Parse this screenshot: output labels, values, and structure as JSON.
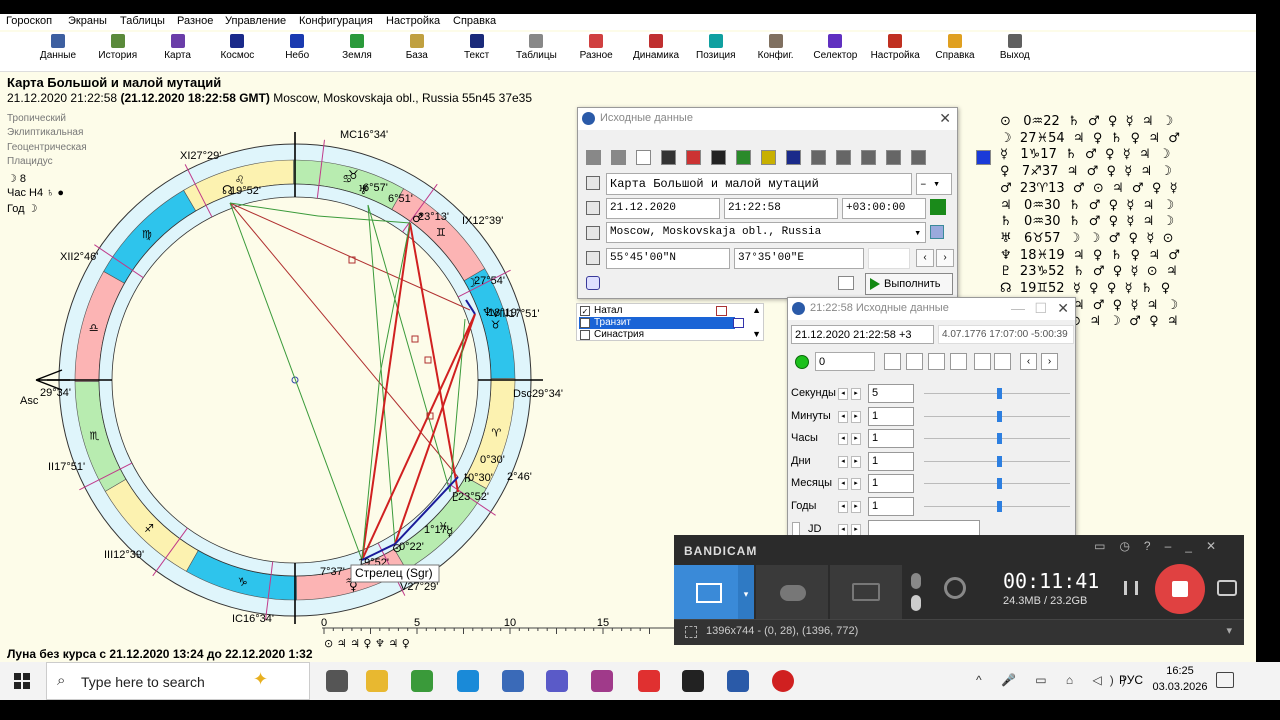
{
  "menu": [
    "Гороскоп",
    "Экраны",
    "Таблицы",
    "Разное",
    "Управление",
    "Конфигурация",
    "Настройка",
    "Справка"
  ],
  "toolbar": [
    {
      "label": "Данные",
      "icon": "data-icon",
      "color": "#3d5fa0"
    },
    {
      "label": "История",
      "icon": "history-icon",
      "color": "#5a8a3a"
    },
    {
      "label": "Карта",
      "icon": "chart-icon",
      "color": "#6a3da8"
    },
    {
      "label": "Космос",
      "icon": "cosmos-icon",
      "color": "#1a2a8a"
    },
    {
      "label": "Небо",
      "icon": "sky-icon",
      "color": "#1a3ab0"
    },
    {
      "label": "Земля",
      "icon": "earth-icon",
      "color": "#2a9a3a"
    },
    {
      "label": "База",
      "icon": "database-icon",
      "color": "#c0a040"
    },
    {
      "label": "Текст",
      "icon": "text-icon",
      "color": "#1a2a7a"
    },
    {
      "label": "Таблицы",
      "icon": "tables-icon",
      "color": "#888888"
    },
    {
      "label": "Разное",
      "icon": "misc-icon",
      "color": "#d04040"
    },
    {
      "label": "Динамика",
      "icon": "dynamics-icon",
      "color": "#c03030"
    },
    {
      "label": "Позиция",
      "icon": "position-icon",
      "color": "#10a0a0"
    },
    {
      "label": "Конфиг.",
      "icon": "config-icon",
      "color": "#807060"
    },
    {
      "label": "Селектор",
      "icon": "selector-icon",
      "color": "#6030c0"
    },
    {
      "label": "Настройка",
      "icon": "settings-icon",
      "color": "#c03020"
    },
    {
      "label": "Справка",
      "icon": "help-icon",
      "color": "#e0a020"
    },
    {
      "label": "Выход",
      "icon": "exit-icon",
      "color": "#606060"
    }
  ],
  "chart": {
    "title": "Карта Большой и малой мутаций",
    "date_plain": "21.12.2020   21:22:58",
    "date_gmt": "(21.12.2020  18:22:58 GMT)",
    "place": "Moscow, Moskovskaja obl., Russia 55n45  37e35",
    "system": [
      "Тропический",
      "Эклиптикальная",
      "Геоцентрическая",
      "Плацидус"
    ],
    "info": [
      "☽  8",
      "Час H4  ♄  ●",
      "Год  ☽"
    ],
    "moon_void": "Луна без курса с 21.12.2020 13:24 до 22.12.2020  1:32",
    "tooltip": "Стрелец (Sgr)",
    "house_labels": [
      "MC16°34'",
      "XI27°29'",
      "XII2°46'",
      "Asc",
      "29°34'",
      "II17°51'",
      "III12°39'",
      "IC16°34'",
      "Dsc29°34'",
      "IX12°39'",
      "VIII17°51'",
      "2°46'",
      "V27°29'"
    ],
    "planet_labels": [
      "19°52'",
      "6°57'",
      "6°51'",
      "23°13'",
      "27°54'",
      "18°19'",
      "0°30'",
      "0°30'",
      "23°52'",
      "1°17'",
      "0°22'",
      "7°37'",
      "19°52'"
    ],
    "scale": [
      "0",
      "5",
      "10",
      "15"
    ]
  },
  "aspect_grid": [
    "⊙   0♒22  ♄  ♂  ♀  ☿  ♃  ☽",
    "☽  27♓54  ♃  ♀  ♄  ♀  ♃  ♂",
    "☿   1♑17  ♄  ♂  ♀  ☿  ♃  ☽",
    "♀   7♐37  ♃  ♂  ♀  ☿  ♃  ☽",
    "♂  23♈13  ♂  ⊙  ♃  ♂  ♀  ☿",
    "♃   0♒30  ♄  ♂  ♀  ☿  ♃  ☽",
    "♄   0♒30  ♄  ♂  ♀  ☿  ♃  ☽",
    "♅   6♉57  ☽  ☽  ♂  ♀  ☿  ⊙",
    "♆  18♓19  ♃  ♀  ♄  ♀  ♃  ♂",
    "♇  23♑52  ♄  ♂  ♀  ☿  ⊙  ♃",
    "☊  19♊52  ☿  ♀  ♀  ☿  ♄  ♀",
    "☋  19♐52  ♃  ♂  ♀  ☿  ♃  ☽",
    "A  29♌34  ⊙  ♃  ☽  ♂  ♀  ♃"
  ],
  "dialog_main": {
    "title": "Исходные данные",
    "name": "Карта Большой и малой мутаций",
    "name_opt": "–",
    "date": "21.12.2020",
    "time": "21:22:58",
    "tz": "+03:00:00",
    "place": "Moscow, Moskovskaja obl., Russia",
    "lat": "55°45'00\"N",
    "lon": "37°35'00\"E",
    "run_button": "Выполнить"
  },
  "chart_types": [
    {
      "label": "Натал",
      "checked": true
    },
    {
      "label": "Транзит",
      "checked": false
    },
    {
      "label": "Синастрия",
      "checked": false
    }
  ],
  "dialog_transit": {
    "title": "21:22:58 Исходные данные",
    "field_left": "21.12.2020  21:22:58  +3",
    "field_right": "4.07.1776   17:07:00  -5:00:39",
    "counter": "0",
    "rows": [
      {
        "label": "Секунды",
        "value": "5",
        "level": 0.5
      },
      {
        "label": "Минуты",
        "value": "1",
        "level": 0.5
      },
      {
        "label": "Часы",
        "value": "1",
        "level": 0.5
      },
      {
        "label": "Дни",
        "value": "1",
        "level": 0.5
      },
      {
        "label": "Месяцы",
        "value": "1",
        "level": 0.5
      },
      {
        "label": "Годы",
        "value": "1",
        "level": 0.5
      }
    ],
    "jd_label": "JD",
    "jd_value": ""
  },
  "bandicam": {
    "logo": "BANDICAM",
    "time": "00:11:41",
    "size": "24.3MB / 23.2GB",
    "region": "1396x744 - (0, 28), (1396, 772)"
  },
  "taskbar": {
    "search_placeholder": "Type here to search",
    "lang": "РУС",
    "time": "16:25",
    "date": "03.03.2026"
  }
}
